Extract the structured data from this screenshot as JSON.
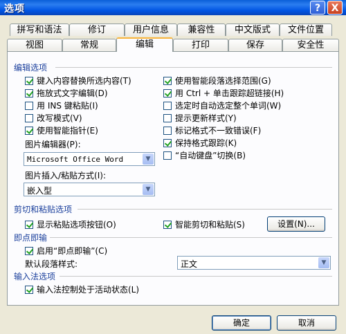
{
  "window": {
    "title": "选项",
    "help_glyph": "?",
    "close_glyph": "X"
  },
  "tabs_row1": [
    "拼写和语法",
    "修订",
    "用户信息",
    "兼容性",
    "中文版式",
    "文件位置"
  ],
  "tabs_row2": [
    "视图",
    "常规",
    "编辑",
    "打印",
    "保存",
    "安全性"
  ],
  "active_tab": "编辑",
  "edit_options": {
    "title": "编辑选项",
    "left": [
      {
        "label": "键入内容替换所选内容(T)",
        "checked": true
      },
      {
        "label": "拖放式文字编辑(D)",
        "checked": true
      },
      {
        "label": "用 INS 键粘贴(I)",
        "checked": false
      },
      {
        "label": "改写模式(V)",
        "checked": false
      },
      {
        "label": "使用智能指针(E)",
        "checked": true
      }
    ],
    "right": [
      {
        "label": "使用智能段落选择范围(G)",
        "checked": true
      },
      {
        "label": "用 Ctrl + 单击跟踪超链接(H)",
        "checked": true
      },
      {
        "label": "选定时自动选定整个单词(W)",
        "checked": false
      },
      {
        "label": "提示更新样式(Y)",
        "checked": false
      },
      {
        "label": "标记格式不一致错误(F)",
        "checked": false
      },
      {
        "label": "保持格式跟踪(K)",
        "checked": true
      },
      {
        "label": "“自动键盘”切换(B)",
        "checked": false
      }
    ],
    "picture_editor_label": "图片编辑器(P):",
    "picture_editor_value": "Microsoft Office Word",
    "insert_mode_label": "图片插入/粘贴方式(I):",
    "insert_mode_value": "嵌入型"
  },
  "cut_paste": {
    "title": "剪切和粘贴选项",
    "show_paste_buttons": {
      "label": "显示粘贴选项按钮(O)",
      "checked": true
    },
    "smart_cut": {
      "label": "智能剪切和粘贴(S)",
      "checked": true
    },
    "settings_button": "设置(N)..."
  },
  "click_type": {
    "title": "即点即输",
    "enable": {
      "label": "启用“即点即输”(C)",
      "checked": true
    },
    "default_style_label": "默认段落样式:",
    "default_style_value": "正文"
  },
  "ime": {
    "title": "输入法选项",
    "control": {
      "label": "输入法控制处于活动状态(L)",
      "checked": true
    }
  },
  "footer": {
    "ok": "确定",
    "cancel": "取消"
  }
}
